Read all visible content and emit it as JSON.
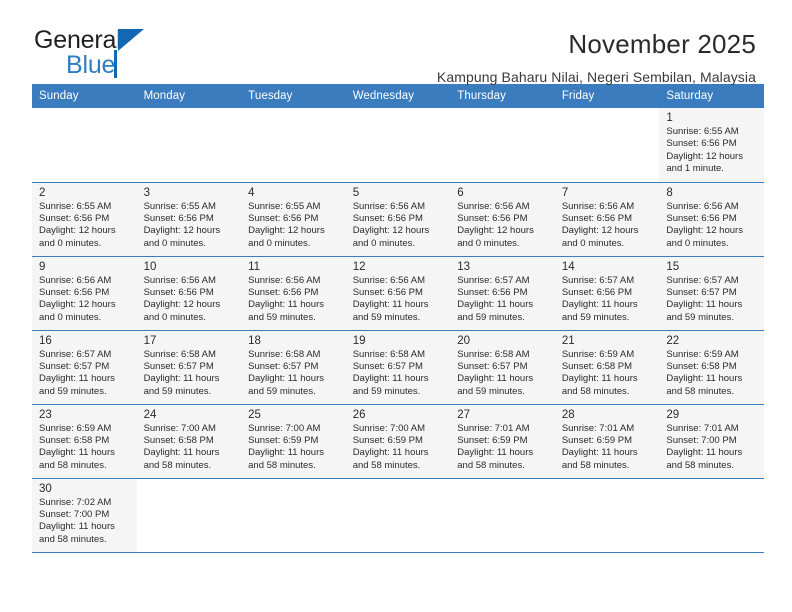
{
  "logo": {
    "word_one": "General",
    "word_two": "Blue",
    "triangle_icon": "triangle-icon",
    "brand_blue": "#1268b3",
    "brand_blue_light": "#2f7dc0"
  },
  "header": {
    "title": "November 2025",
    "subtitle": "Kampung Baharu Nilai, Negeri Sembilan, Malaysia"
  },
  "calendar": {
    "header_bg": "#3a7cbe",
    "cell_bg": "#f5f5f5",
    "labels": {
      "sunrise": "Sunrise:",
      "sunset": "Sunset:",
      "daylight": "Daylight:"
    },
    "weekdays": [
      "Sunday",
      "Monday",
      "Tuesday",
      "Wednesday",
      "Thursday",
      "Friday",
      "Saturday"
    ],
    "weeks": [
      [
        {
          "empty": true
        },
        {
          "empty": true
        },
        {
          "empty": true
        },
        {
          "empty": true
        },
        {
          "empty": true
        },
        {
          "empty": true
        },
        {
          "day": "1",
          "sunrise": "Sunrise: 6:55 AM",
          "sunset": "Sunset: 6:56 PM",
          "daylight_1": "Daylight: 12 hours",
          "daylight_2": "and 1 minute."
        }
      ],
      [
        {
          "day": "2",
          "sunrise": "Sunrise: 6:55 AM",
          "sunset": "Sunset: 6:56 PM",
          "daylight_1": "Daylight: 12 hours",
          "daylight_2": "and 0 minutes."
        },
        {
          "day": "3",
          "sunrise": "Sunrise: 6:55 AM",
          "sunset": "Sunset: 6:56 PM",
          "daylight_1": "Daylight: 12 hours",
          "daylight_2": "and 0 minutes."
        },
        {
          "day": "4",
          "sunrise": "Sunrise: 6:55 AM",
          "sunset": "Sunset: 6:56 PM",
          "daylight_1": "Daylight: 12 hours",
          "daylight_2": "and 0 minutes."
        },
        {
          "day": "5",
          "sunrise": "Sunrise: 6:56 AM",
          "sunset": "Sunset: 6:56 PM",
          "daylight_1": "Daylight: 12 hours",
          "daylight_2": "and 0 minutes."
        },
        {
          "day": "6",
          "sunrise": "Sunrise: 6:56 AM",
          "sunset": "Sunset: 6:56 PM",
          "daylight_1": "Daylight: 12 hours",
          "daylight_2": "and 0 minutes."
        },
        {
          "day": "7",
          "sunrise": "Sunrise: 6:56 AM",
          "sunset": "Sunset: 6:56 PM",
          "daylight_1": "Daylight: 12 hours",
          "daylight_2": "and 0 minutes."
        },
        {
          "day": "8",
          "sunrise": "Sunrise: 6:56 AM",
          "sunset": "Sunset: 6:56 PM",
          "daylight_1": "Daylight: 12 hours",
          "daylight_2": "and 0 minutes."
        }
      ],
      [
        {
          "day": "9",
          "sunrise": "Sunrise: 6:56 AM",
          "sunset": "Sunset: 6:56 PM",
          "daylight_1": "Daylight: 12 hours",
          "daylight_2": "and 0 minutes."
        },
        {
          "day": "10",
          "sunrise": "Sunrise: 6:56 AM",
          "sunset": "Sunset: 6:56 PM",
          "daylight_1": "Daylight: 12 hours",
          "daylight_2": "and 0 minutes."
        },
        {
          "day": "11",
          "sunrise": "Sunrise: 6:56 AM",
          "sunset": "Sunset: 6:56 PM",
          "daylight_1": "Daylight: 11 hours",
          "daylight_2": "and 59 minutes."
        },
        {
          "day": "12",
          "sunrise": "Sunrise: 6:56 AM",
          "sunset": "Sunset: 6:56 PM",
          "daylight_1": "Daylight: 11 hours",
          "daylight_2": "and 59 minutes."
        },
        {
          "day": "13",
          "sunrise": "Sunrise: 6:57 AM",
          "sunset": "Sunset: 6:56 PM",
          "daylight_1": "Daylight: 11 hours",
          "daylight_2": "and 59 minutes."
        },
        {
          "day": "14",
          "sunrise": "Sunrise: 6:57 AM",
          "sunset": "Sunset: 6:56 PM",
          "daylight_1": "Daylight: 11 hours",
          "daylight_2": "and 59 minutes."
        },
        {
          "day": "15",
          "sunrise": "Sunrise: 6:57 AM",
          "sunset": "Sunset: 6:57 PM",
          "daylight_1": "Daylight: 11 hours",
          "daylight_2": "and 59 minutes."
        }
      ],
      [
        {
          "day": "16",
          "sunrise": "Sunrise: 6:57 AM",
          "sunset": "Sunset: 6:57 PM",
          "daylight_1": "Daylight: 11 hours",
          "daylight_2": "and 59 minutes."
        },
        {
          "day": "17",
          "sunrise": "Sunrise: 6:58 AM",
          "sunset": "Sunset: 6:57 PM",
          "daylight_1": "Daylight: 11 hours",
          "daylight_2": "and 59 minutes."
        },
        {
          "day": "18",
          "sunrise": "Sunrise: 6:58 AM",
          "sunset": "Sunset: 6:57 PM",
          "daylight_1": "Daylight: 11 hours",
          "daylight_2": "and 59 minutes."
        },
        {
          "day": "19",
          "sunrise": "Sunrise: 6:58 AM",
          "sunset": "Sunset: 6:57 PM",
          "daylight_1": "Daylight: 11 hours",
          "daylight_2": "and 59 minutes."
        },
        {
          "day": "20",
          "sunrise": "Sunrise: 6:58 AM",
          "sunset": "Sunset: 6:57 PM",
          "daylight_1": "Daylight: 11 hours",
          "daylight_2": "and 59 minutes."
        },
        {
          "day": "21",
          "sunrise": "Sunrise: 6:59 AM",
          "sunset": "Sunset: 6:58 PM",
          "daylight_1": "Daylight: 11 hours",
          "daylight_2": "and 58 minutes."
        },
        {
          "day": "22",
          "sunrise": "Sunrise: 6:59 AM",
          "sunset": "Sunset: 6:58 PM",
          "daylight_1": "Daylight: 11 hours",
          "daylight_2": "and 58 minutes."
        }
      ],
      [
        {
          "day": "23",
          "sunrise": "Sunrise: 6:59 AM",
          "sunset": "Sunset: 6:58 PM",
          "daylight_1": "Daylight: 11 hours",
          "daylight_2": "and 58 minutes."
        },
        {
          "day": "24",
          "sunrise": "Sunrise: 7:00 AM",
          "sunset": "Sunset: 6:58 PM",
          "daylight_1": "Daylight: 11 hours",
          "daylight_2": "and 58 minutes."
        },
        {
          "day": "25",
          "sunrise": "Sunrise: 7:00 AM",
          "sunset": "Sunset: 6:59 PM",
          "daylight_1": "Daylight: 11 hours",
          "daylight_2": "and 58 minutes."
        },
        {
          "day": "26",
          "sunrise": "Sunrise: 7:00 AM",
          "sunset": "Sunset: 6:59 PM",
          "daylight_1": "Daylight: 11 hours",
          "daylight_2": "and 58 minutes."
        },
        {
          "day": "27",
          "sunrise": "Sunrise: 7:01 AM",
          "sunset": "Sunset: 6:59 PM",
          "daylight_1": "Daylight: 11 hours",
          "daylight_2": "and 58 minutes."
        },
        {
          "day": "28",
          "sunrise": "Sunrise: 7:01 AM",
          "sunset": "Sunset: 6:59 PM",
          "daylight_1": "Daylight: 11 hours",
          "daylight_2": "and 58 minutes."
        },
        {
          "day": "29",
          "sunrise": "Sunrise: 7:01 AM",
          "sunset": "Sunset: 7:00 PM",
          "daylight_1": "Daylight: 11 hours",
          "daylight_2": "and 58 minutes."
        }
      ],
      [
        {
          "day": "30",
          "sunrise": "Sunrise: 7:02 AM",
          "sunset": "Sunset: 7:00 PM",
          "daylight_1": "Daylight: 11 hours",
          "daylight_2": "and 58 minutes."
        },
        {
          "empty": true
        },
        {
          "empty": true
        },
        {
          "empty": true
        },
        {
          "empty": true
        },
        {
          "empty": true
        },
        {
          "empty": true
        }
      ]
    ]
  }
}
